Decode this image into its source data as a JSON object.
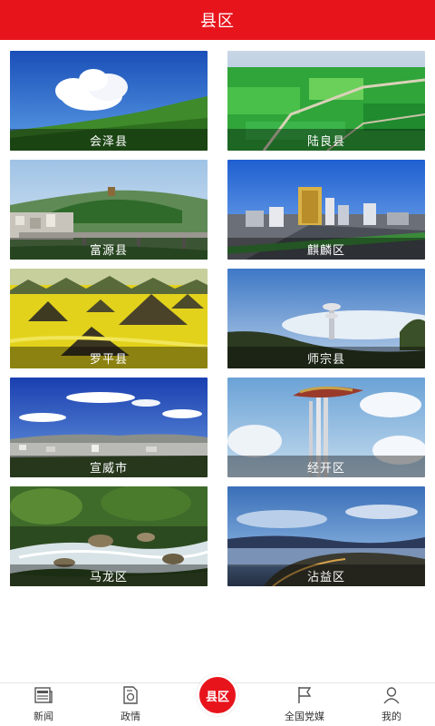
{
  "header": {
    "title": "县区"
  },
  "tiles": [
    {
      "label": "会泽县",
      "scene": "sky-hill-cloud-icon"
    },
    {
      "label": "陆良县",
      "scene": "aerial-farmland-icon"
    },
    {
      "label": "富源县",
      "scene": "town-bridge-icon"
    },
    {
      "label": "麒麟区",
      "scene": "city-skyline-icon"
    },
    {
      "label": "罗平县",
      "scene": "rapeseed-peaks-icon"
    },
    {
      "label": "师宗县",
      "scene": "misty-valley-tower-icon"
    },
    {
      "label": "宣威市",
      "scene": "city-blue-sky-icon"
    },
    {
      "label": "经开区",
      "scene": "tower-sculpture-icon"
    },
    {
      "label": "马龙区",
      "scene": "river-rocks-icon"
    },
    {
      "label": "沾益区",
      "scene": "lake-sunset-icon"
    }
  ],
  "tabbar": {
    "items": [
      {
        "label": "新闻",
        "icon": "newspaper-icon"
      },
      {
        "label": "政情",
        "icon": "document-seal-icon"
      },
      {
        "label": "县区",
        "icon": "county-badge-icon",
        "active": true
      },
      {
        "label": "全国党媒",
        "icon": "flag-icon"
      },
      {
        "label": "我的",
        "icon": "user-icon"
      }
    ]
  },
  "colors": {
    "accent": "#e8141c",
    "tab_text": "#333333"
  }
}
